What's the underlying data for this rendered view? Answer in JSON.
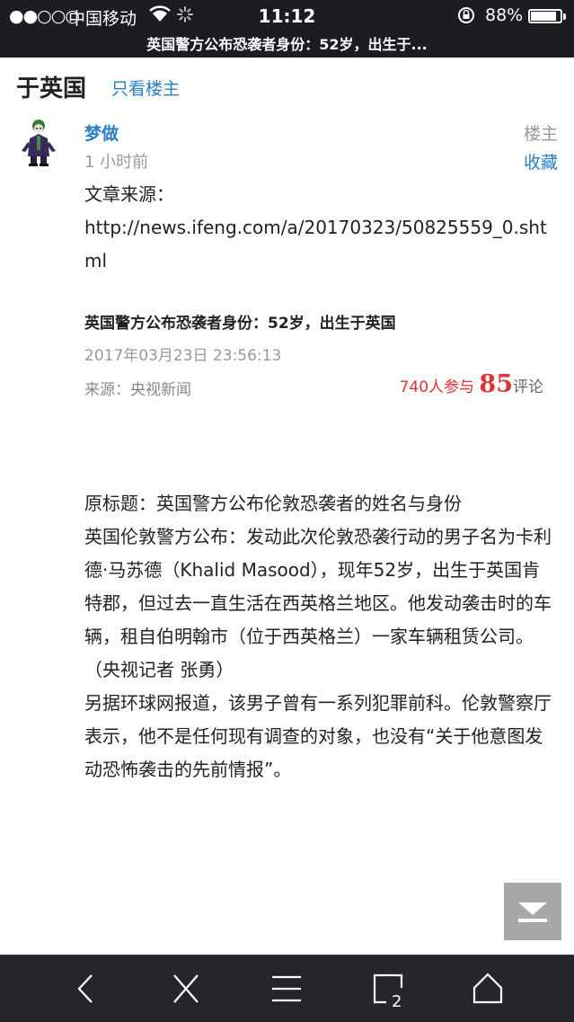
{
  "status_bar": {
    "signal": "●●○○○",
    "carrier": "中国移动",
    "wifi_icon": "wifi-icon",
    "time": "11:12",
    "battery_pct": "88%",
    "battery_level": 0.88,
    "page_title": "英国警方公布恐袭者身份：52岁，出生于..."
  },
  "thread": {
    "title_tail": "于英国",
    "only_op_label": "只看楼主"
  },
  "post": {
    "author": "梦做",
    "time": "1 小时前",
    "floor_label": "楼主",
    "favorite_label": "收藏",
    "source_label": "文章来源：",
    "source_url": "http://news.ifeng.com/a/20170323/50825559_0.shtml",
    "article": {
      "title": "英国警方公布恐袭者身份：52岁，出生于英国",
      "date": "2017年03月23日 23:56:13",
      "source": "来源：央视新闻",
      "participants": "740人参与",
      "comments": "85",
      "comments_word": "评论",
      "body": "原标题：英国警方公布伦敦恐袭者的姓名与身份\n英国伦敦警方公布：发动此次伦敦恐袭行动的男子名为卡利德·马苏德（Khalid Masood），现年52岁，出生于英国肯特郡，但过去一直生活在西英格兰地区。他发动袭击时的车辆，租自伯明翰市（位于西英格兰）一家车辆租赁公司。（央视记者 张勇）\n另据环球网报道，该男子曾有一系列犯罪前科。伦敦警察厅表示，他不是任何现有调查的对象，也没有“关于他意图发动恐怖袭击的先前情报”。"
    }
  },
  "toolbar": {
    "tabs_count": "2",
    "icons": [
      "back-icon",
      "close-icon",
      "menu-icon",
      "tabs-icon",
      "home-icon"
    ]
  },
  "colors": {
    "link_blue": "#2a7fc4",
    "accent_red": "#d33",
    "bar_dark": "#1e1b21"
  }
}
